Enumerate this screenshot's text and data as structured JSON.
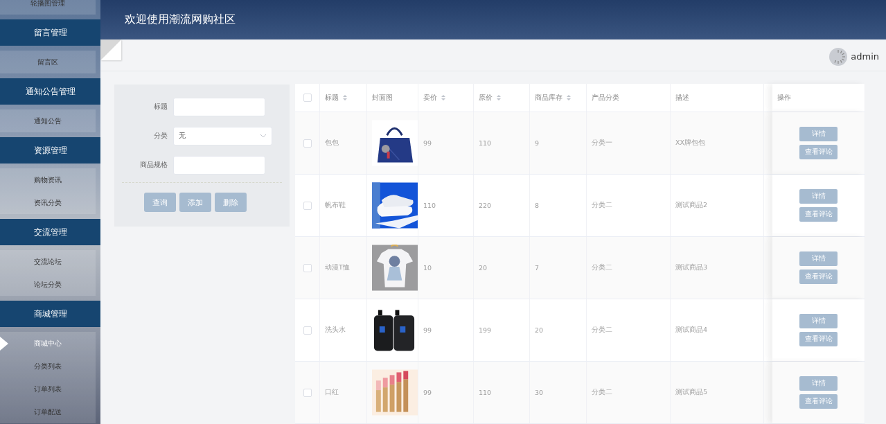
{
  "sidebar": {
    "items": [
      {
        "kind": "item",
        "label": "轮播图管理",
        "selected": false
      },
      {
        "kind": "group",
        "label": "留言管理"
      },
      {
        "kind": "item",
        "label": "留言区",
        "selected": false
      },
      {
        "kind": "group",
        "label": "通知公告管理"
      },
      {
        "kind": "item",
        "label": "通知公告",
        "selected": false
      },
      {
        "kind": "group",
        "label": "资源管理"
      },
      {
        "kind": "item",
        "label": "购物资讯",
        "selected": false
      },
      {
        "kind": "item",
        "label": "资讯分类",
        "selected": false
      },
      {
        "kind": "group",
        "label": "交流管理"
      },
      {
        "kind": "item",
        "label": "交流论坛",
        "selected": false
      },
      {
        "kind": "item",
        "label": "论坛分类",
        "selected": false
      },
      {
        "kind": "group",
        "label": "商城管理"
      },
      {
        "kind": "item",
        "label": "商城中心",
        "selected": true
      },
      {
        "kind": "item",
        "label": "分类列表",
        "selected": false
      },
      {
        "kind": "item",
        "label": "订单列表",
        "selected": false
      },
      {
        "kind": "item",
        "label": "订单配送",
        "selected": false
      }
    ]
  },
  "header": {
    "title": "欢迎使用潮流网购社区"
  },
  "user": {
    "name": "admin"
  },
  "search": {
    "fields": [
      {
        "kind": "input",
        "label": "标题"
      },
      {
        "kind": "select",
        "label": "分类",
        "value": "无"
      },
      {
        "kind": "input",
        "label": "商品规格"
      }
    ],
    "buttons": [
      "查询",
      "添加",
      "删除"
    ]
  },
  "table": {
    "select_all": {
      "checked": false
    },
    "columns": [
      {
        "label": "标题",
        "sortable": true
      },
      {
        "label": "封面图",
        "sortable": false
      },
      {
        "label": "卖价",
        "sortable": true
      },
      {
        "label": "原价",
        "sortable": true
      },
      {
        "label": "商品库存",
        "sortable": true
      },
      {
        "label": "产品分类",
        "sortable": false
      },
      {
        "label": "描述",
        "sortable": false
      },
      {
        "label": "操作",
        "sortable": false
      }
    ],
    "rows": [
      {
        "checked": false,
        "cells": [
          "包包",
          "",
          "99",
          "110",
          "9",
          "分类一",
          "XX牌包包"
        ],
        "actions": [
          "详情",
          "查看评论"
        ]
      },
      {
        "checked": false,
        "cells": [
          "帆布鞋",
          "",
          "110",
          "220",
          "8",
          "分类二",
          "测试商品2"
        ],
        "actions": [
          "详情",
          "查看评论"
        ]
      },
      {
        "checked": false,
        "cells": [
          "动漫T恤",
          "",
          "10",
          "20",
          "7",
          "分类二",
          "测试商品3"
        ],
        "actions": [
          "详情",
          "查看评论"
        ]
      },
      {
        "checked": false,
        "cells": [
          "洗头水",
          "",
          "99",
          "199",
          "20",
          "分类二",
          "测试商品4"
        ],
        "actions": [
          "详情",
          "查看评论"
        ]
      },
      {
        "checked": false,
        "cells": [
          "口红",
          "",
          "99",
          "110",
          "30",
          "分类二",
          "测试商品5"
        ],
        "actions": [
          "详情",
          "查看评论"
        ]
      }
    ]
  }
}
